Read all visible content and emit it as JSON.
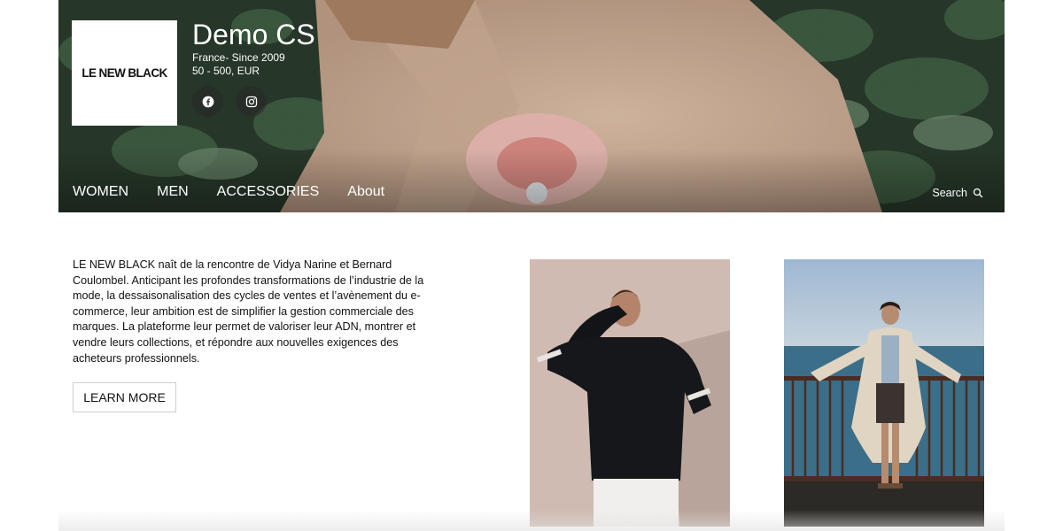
{
  "brand": {
    "logo_text": "LE NEW BLACK",
    "name": "Demo CS",
    "origin": "France- Since 2009",
    "price_range": "50 - 500, EUR"
  },
  "socials": [
    {
      "icon": "facebook-icon"
    },
    {
      "icon": "instagram-icon"
    }
  ],
  "nav": {
    "items": [
      "WOMEN",
      "MEN",
      "ACCESSORIES",
      "About"
    ],
    "search_label": "Search"
  },
  "about": {
    "text": "LE NEW BLACK naît de la rencontre de Vidya Narine et Bernard Coulombel. Anticipant les profondes transformations de l’industrie de la mode, la dessaisonalisation des cycles de ventes et l’avènement du e-commerce, leur ambition est de simplifier la gestion commerciale des marques. La plateforme leur permet de valoriser leur ADN, montrer et vendre leurs collections, et répondre aux nouvelles exigences des acheteurs professionnels.",
    "cta_label": "LEARN MORE"
  },
  "colors": {
    "nav_text": "#ffffff",
    "button_border": "#cfcfcf",
    "hero_foliage": "#2f4a33"
  }
}
